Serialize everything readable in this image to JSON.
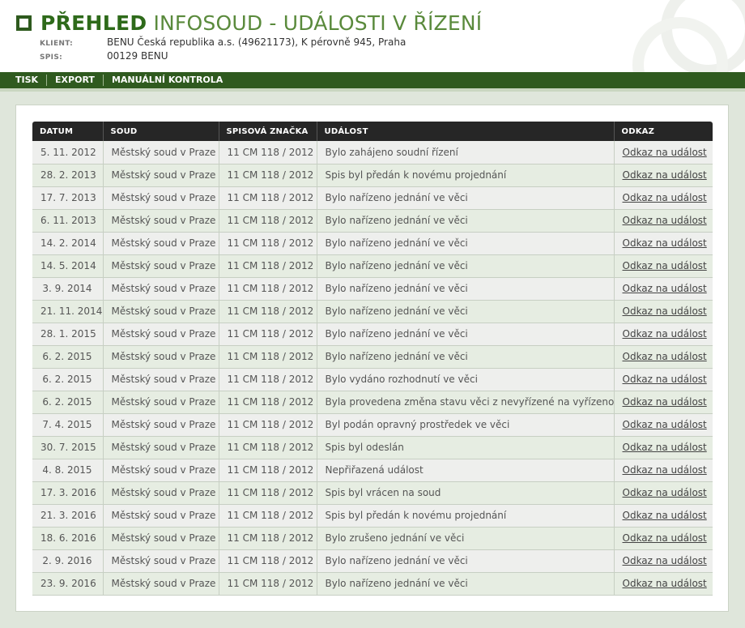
{
  "header": {
    "title_bold": "PŘEHLED",
    "title_light": "INFOSOUD - UDÁLOSTI V ŘÍZENÍ",
    "client_label": "KLIENT:",
    "client_value": "BENU Česká republika a.s. (49621173), K pérovně 945, Praha",
    "spis_label": "SPIS:",
    "spis_value": "00129 BENU"
  },
  "menu": {
    "items": [
      {
        "label": "TISK"
      },
      {
        "label": "EXPORT"
      },
      {
        "label": "MANUÁLNÍ KONTROLA"
      }
    ]
  },
  "table": {
    "headers": [
      "DATUM",
      "SOUD",
      "SPISOVÁ ZNAČKA",
      "UDÁLOST",
      "ODKAZ"
    ],
    "rows": [
      {
        "date": "5. 11. 2012",
        "court": "Městský soud v Praze",
        "file": "11 CM 118 / 2012",
        "event": "Bylo zahájeno soudní řízení",
        "link": "Odkaz na událost"
      },
      {
        "date": "28. 2. 2013",
        "court": "Městský soud v Praze",
        "file": "11 CM 118 / 2012",
        "event": "Spis byl předán k novému projednání",
        "link": "Odkaz na událost"
      },
      {
        "date": "17. 7. 2013",
        "court": "Městský soud v Praze",
        "file": "11 CM 118 / 2012",
        "event": "Bylo nařízeno jednání ve věci",
        "link": "Odkaz na událost"
      },
      {
        "date": "6. 11. 2013",
        "court": "Městský soud v Praze",
        "file": "11 CM 118 / 2012",
        "event": "Bylo nařízeno jednání ve věci",
        "link": "Odkaz na událost"
      },
      {
        "date": "14. 2. 2014",
        "court": "Městský soud v Praze",
        "file": "11 CM 118 / 2012",
        "event": "Bylo nařízeno jednání ve věci",
        "link": "Odkaz na událost"
      },
      {
        "date": "14. 5. 2014",
        "court": "Městský soud v Praze",
        "file": "11 CM 118 / 2012",
        "event": "Bylo nařízeno jednání ve věci",
        "link": "Odkaz na událost"
      },
      {
        "date": "3. 9. 2014",
        "court": "Městský soud v Praze",
        "file": "11 CM 118 / 2012",
        "event": "Bylo nařízeno jednání ve věci",
        "link": "Odkaz na událost"
      },
      {
        "date": "21. 11. 2014",
        "court": "Městský soud v Praze",
        "file": "11 CM 118 / 2012",
        "event": "Bylo nařízeno jednání ve věci",
        "link": "Odkaz na událost"
      },
      {
        "date": "28. 1. 2015",
        "court": "Městský soud v Praze",
        "file": "11 CM 118 / 2012",
        "event": "Bylo nařízeno jednání ve věci",
        "link": "Odkaz na událost"
      },
      {
        "date": "6. 2. 2015",
        "court": "Městský soud v Praze",
        "file": "11 CM 118 / 2012",
        "event": "Bylo nařízeno jednání ve věci",
        "link": "Odkaz na událost"
      },
      {
        "date": "6. 2. 2015",
        "court": "Městský soud v Praze",
        "file": "11 CM 118 / 2012",
        "event": "Bylo vydáno rozhodnutí ve věci",
        "link": "Odkaz na událost"
      },
      {
        "date": "6. 2. 2015",
        "court": "Městský soud v Praze",
        "file": "11 CM 118 / 2012",
        "event": "Byla provedena změna stavu věci z nevyřízené na vyřízenou.",
        "link": "Odkaz na událost"
      },
      {
        "date": "7. 4. 2015",
        "court": "Městský soud v Praze",
        "file": "11 CM 118 / 2012",
        "event": "Byl podán opravný prostředek ve věci",
        "link": "Odkaz na událost"
      },
      {
        "date": "30. 7. 2015",
        "court": "Městský soud v Praze",
        "file": "11 CM 118 / 2012",
        "event": "Spis byl odeslán",
        "link": "Odkaz na událost"
      },
      {
        "date": "4. 8. 2015",
        "court": "Městský soud v Praze",
        "file": "11 CM 118 / 2012",
        "event": "Nepřiřazená událost",
        "link": "Odkaz na událost"
      },
      {
        "date": "17. 3. 2016",
        "court": "Městský soud v Praze",
        "file": "11 CM 118 / 2012",
        "event": "Spis byl vrácen na soud",
        "link": "Odkaz na událost"
      },
      {
        "date": "21. 3. 2016",
        "court": "Městský soud v Praze",
        "file": "11 CM 118 / 2012",
        "event": "Spis byl předán k novému projednání",
        "link": "Odkaz na událost"
      },
      {
        "date": "18. 6. 2016",
        "court": "Městský soud v Praze",
        "file": "11 CM 118 / 2012",
        "event": "Bylo zrušeno jednání ve věci",
        "link": "Odkaz na událost"
      },
      {
        "date": "2. 9. 2016",
        "court": "Městský soud v Praze",
        "file": "11 CM 118 / 2012",
        "event": "Bylo nařízeno jednání ve věci",
        "link": "Odkaz na událost"
      },
      {
        "date": "23. 9. 2016",
        "court": "Městský soud v Praze",
        "file": "11 CM 118 / 2012",
        "event": "Bylo nařízeno jednání ve věci",
        "link": "Odkaz na událost"
      }
    ]
  }
}
